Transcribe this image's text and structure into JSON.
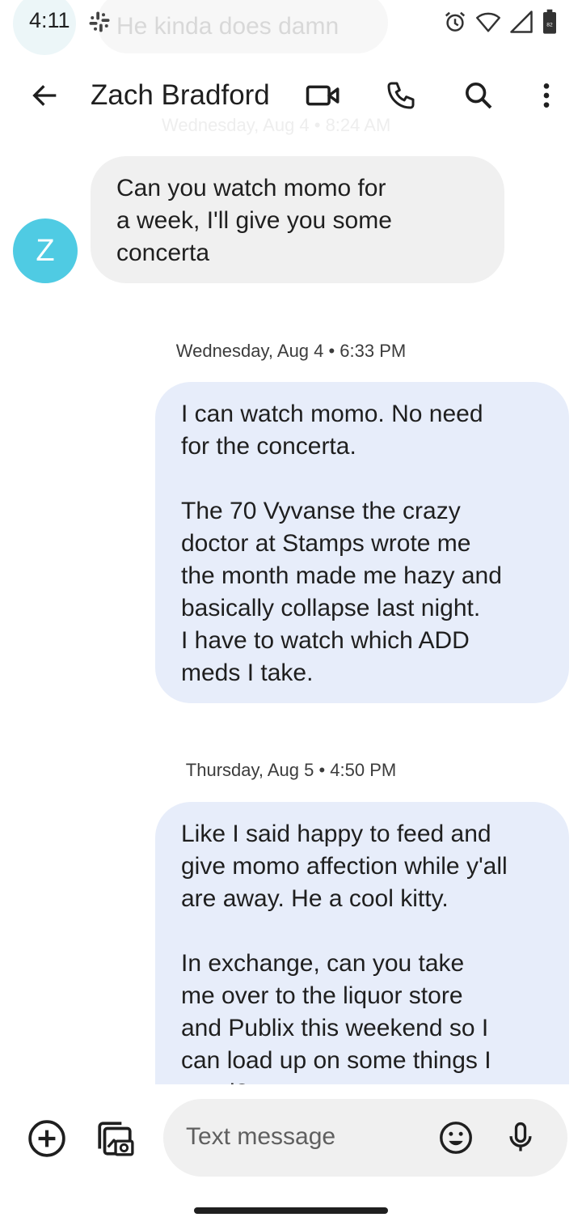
{
  "status_bar": {
    "time": "4:11",
    "ghost_notification": "He kinda does damn",
    "battery_level": "82"
  },
  "header": {
    "contact_name": "Zach Bradford",
    "ghost_timestamp": "Wednesday, Aug 4 • 8:24 AM"
  },
  "contact": {
    "avatar_initial": "Z",
    "avatar_color": "#4fcbe3"
  },
  "messages": [
    {
      "direction": "incoming",
      "text": "Can you watch momo for\na week, I'll give you some\nconcerta"
    },
    {
      "direction": "outgoing",
      "timestamp": "Wednesday, Aug 4 • 6:33 PM",
      "text": "I can watch momo. No need\nfor the concerta.\n\nThe 70 Vyvanse the crazy\ndoctor at Stamps wrote me\nthe month made me hazy and\nbasically collapse last night.\nI have  to watch which ADD\nmeds I take."
    },
    {
      "direction": "outgoing",
      "timestamp": "Thursday, Aug 5 • 4:50 PM",
      "text": "Like I said happy to feed and\ngive momo affection while y'all\nare away. He a cool kitty.\n\nIn exchange, can you take\nme over to the liquor store\nand Publix this weekend so I\ncan load up on some things I\nneed?"
    }
  ],
  "compose": {
    "placeholder": "Text message"
  },
  "colors": {
    "incoming_bubble": "#f0f0f0",
    "outgoing_bubble": "#e7edfa"
  }
}
